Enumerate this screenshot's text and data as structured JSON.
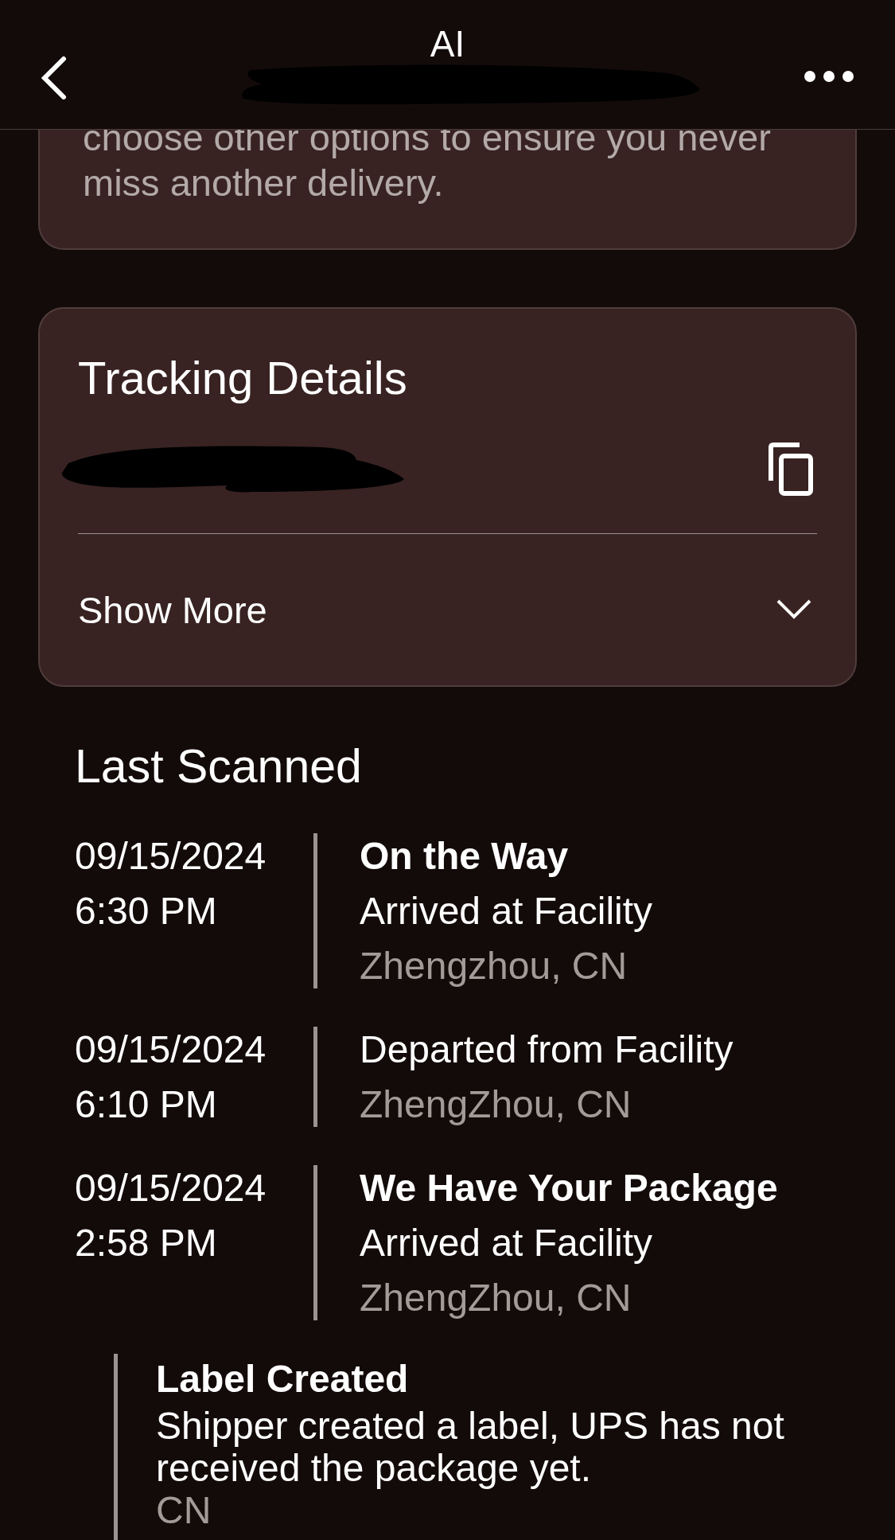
{
  "header": {
    "title": "AI"
  },
  "notice": {
    "lines": [
      "choose other options to ensure you never",
      "miss another delivery."
    ]
  },
  "tracking": {
    "title": "Tracking Details",
    "show_more": "Show More"
  },
  "history": {
    "title": "Last Scanned",
    "events": [
      {
        "date": "09/15/2024",
        "time": "6:30 PM",
        "status": "On the Way",
        "description": "Arrived at Facility",
        "location": "Zhengzhou, CN"
      },
      {
        "date": "09/15/2024",
        "time": "6:10 PM",
        "description": "Departed from Facility",
        "location": "ZhengZhou, CN"
      },
      {
        "date": "09/15/2024",
        "time": "2:58 PM",
        "status": "We Have Your Package",
        "description": "Arrived at Facility",
        "location": "ZhengZhou, CN"
      }
    ],
    "label_created": {
      "status": "Label Created",
      "description": "Shipper created a label, UPS has not received the package yet.",
      "location": "CN"
    }
  }
}
